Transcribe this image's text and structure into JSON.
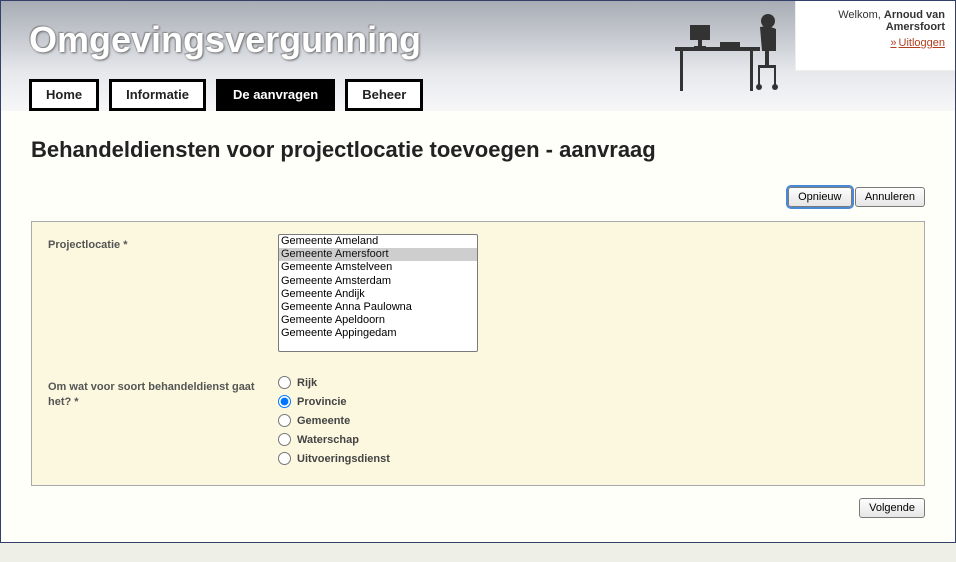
{
  "app_title": "Omgevingsvergunning",
  "welcome": {
    "prefix": "Welkom, ",
    "user": "Arnoud van Amersfoort",
    "logout": "Uitloggen"
  },
  "nav": {
    "home": "Home",
    "informatie": "Informatie",
    "aanvragen": "De aanvragen",
    "beheer": "Beheer",
    "active": "aanvragen"
  },
  "heading": "Behandeldiensten voor projectlocatie toevoegen - aanvraag",
  "buttons": {
    "opnieuw": "Opnieuw",
    "annuleren": "Annuleren",
    "volgende": "Volgende"
  },
  "form": {
    "projectlocatie_label": "Projectlocatie *",
    "projectlocatie_options": [
      "Gemeente Ameland",
      "Gemeente Amersfoort",
      "Gemeente Amstelveen",
      "Gemeente Amsterdam",
      "Gemeente Andijk",
      "Gemeente Anna Paulowna",
      "Gemeente Apeldoorn",
      "Gemeente Appingedam"
    ],
    "projectlocatie_selected": "Gemeente Amersfoort",
    "soort_label": "Om wat voor soort behandeldienst gaat het? *",
    "soort_options": {
      "rijk": "Rijk",
      "provincie": "Provincie",
      "gemeente": "Gemeente",
      "waterschap": "Waterschap",
      "uitvoeringsdienst": "Uitvoeringsdienst"
    },
    "soort_selected": "provincie"
  }
}
